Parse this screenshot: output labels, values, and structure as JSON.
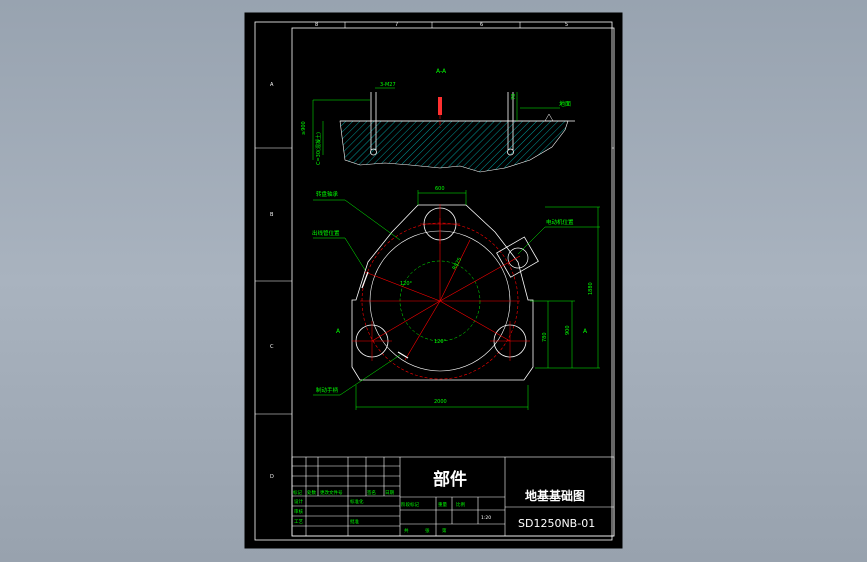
{
  "colors": {
    "background": "#a4aeba",
    "sheet": "#000000",
    "frame": "#ffffff",
    "annotation": "#00ff00",
    "centerline": "#ff0000",
    "dimension": "#00ff00",
    "soil_hatch": "#00d9d9",
    "ground_fill": "#0e3a3a"
  },
  "border_zones": {
    "top": [
      "8",
      "7",
      "6",
      "5"
    ],
    "left": [
      "A",
      "B",
      "C",
      "D"
    ]
  },
  "section": {
    "title": "A-A",
    "bolt_callout": "3-M27",
    "ground_label": "地面",
    "dim_depth": "≥900",
    "dim_foundation": "C=30(混凝土)",
    "dim_top": "70"
  },
  "plan": {
    "dim_width_top": "600",
    "dim_radius": "R825",
    "angle_1": "120°",
    "angle_2": "120°",
    "dim_right_total": "1880",
    "dim_right_1": "780",
    "dim_right_2": "900",
    "dim_bottom": "2000",
    "section_mark_left": "A",
    "section_mark_right": "A",
    "label_slew_bearing": "转盘轴承",
    "label_outlet": "出线管位置",
    "label_motor": "电动机位置",
    "label_handwheel": "制动手柄"
  },
  "title_block": {
    "category": "部件",
    "drawing_name": "地基基础图",
    "drawing_no": "SD1250NB-01",
    "scale": "1:20",
    "cells": [
      "标记",
      "处数",
      "更改文件号",
      "签名",
      "日期",
      "设计",
      "标准化",
      "审核",
      "工艺",
      "批准",
      "阶段标记",
      "重量",
      "比例",
      "共",
      "张",
      "第"
    ]
  }
}
